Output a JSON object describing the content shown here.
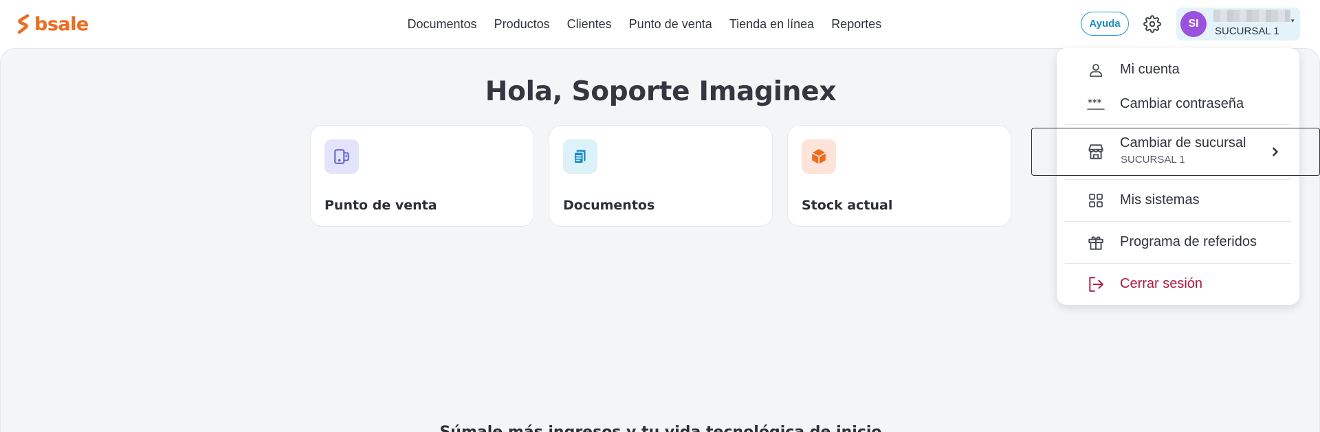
{
  "brand": {
    "name": "bsale",
    "color": "#f26a1b"
  },
  "nav": {
    "items": [
      {
        "label": "Documentos"
      },
      {
        "label": "Productos"
      },
      {
        "label": "Clientes"
      },
      {
        "label": "Punto de venta"
      },
      {
        "label": "Tienda en línea"
      },
      {
        "label": "Reportes"
      }
    ]
  },
  "header": {
    "help_label": "Ayuda",
    "settings_icon": "gear-icon",
    "user": {
      "initials": "SI",
      "branch": "SUCURSAL 1",
      "avatar_color": "#9b51e0"
    }
  },
  "main": {
    "greeting": "Hola, Soporte Imaginex",
    "cards": [
      {
        "label": "Punto de venta",
        "icon": "pos-terminal-icon",
        "icon_bg": "#e3e4fb",
        "icon_color": "#5b5fdc"
      },
      {
        "label": "Documentos",
        "icon": "document-icon",
        "icon_bg": "#ddf1f8",
        "icon_color": "#1a8cc9"
      },
      {
        "label": "Stock actual",
        "icon": "box-icon",
        "icon_bg": "#fde3d8",
        "icon_color": "#f26a1b"
      }
    ],
    "bottom_text": "Súmale más ingresos y tu vida tecnológica de inicio"
  },
  "dropdown": {
    "items": [
      {
        "label": "Mi cuenta",
        "icon": "user-icon"
      },
      {
        "label": "Cambiar contraseña",
        "icon": "password-icon"
      },
      {
        "label": "Cambiar de sucursal",
        "sublabel": "SUCURSAL 1",
        "icon": "store-icon",
        "chevron": "chevron-right-icon"
      },
      {
        "label": "Mis sistemas",
        "icon": "grid-icon"
      },
      {
        "label": "Programa de referidos",
        "icon": "gift-icon"
      },
      {
        "label": "Cerrar sesión",
        "icon": "logout-icon",
        "color": "#b3173b"
      }
    ]
  }
}
